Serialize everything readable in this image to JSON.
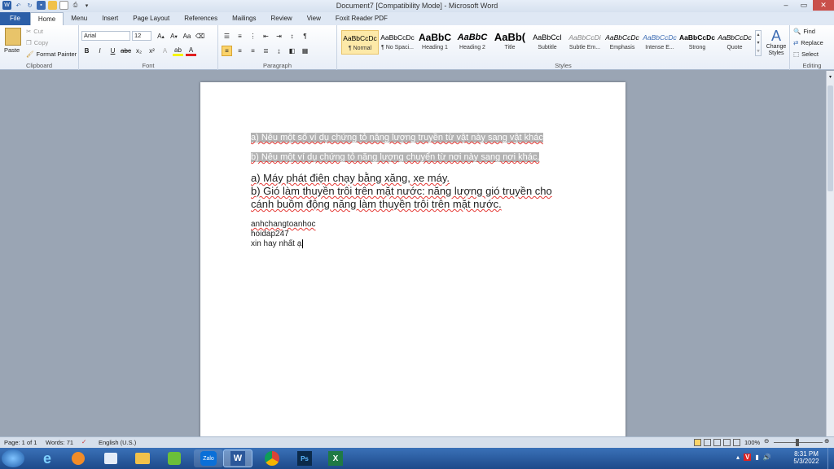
{
  "window": {
    "title": "Document7 [Compatibility Mode] - Microsoft Word",
    "controls": [
      "–",
      "▭",
      "✕"
    ]
  },
  "tabs": [
    "File",
    "Home",
    "Menu",
    "Insert",
    "Page Layout",
    "References",
    "Mailings",
    "Review",
    "View",
    "Foxit Reader PDF"
  ],
  "ribbon": {
    "clipboard": {
      "label": "Clipboard",
      "paste": "Paste",
      "cut": "Cut",
      "copy": "Copy",
      "format_painter": "Format Painter"
    },
    "font": {
      "label": "Font",
      "family": "Arial",
      "size": "12"
    },
    "paragraph": {
      "label": "Paragraph"
    },
    "styles": {
      "label": "Styles",
      "items": [
        {
          "preview": "AaBbCcDc",
          "name": "¶ Normal"
        },
        {
          "preview": "AaBbCcDc",
          "name": "¶ No Spaci..."
        },
        {
          "preview": "AaBbC",
          "name": "Heading 1"
        },
        {
          "preview": "AaBbC",
          "name": "Heading 2"
        },
        {
          "preview": "AaBb(",
          "name": "Title"
        },
        {
          "preview": "AaBbCcI",
          "name": "Subtitle"
        },
        {
          "preview": "AaBbCcDi",
          "name": "Subtle Em..."
        },
        {
          "preview": "AaBbCcDc",
          "name": "Emphasis"
        },
        {
          "preview": "AaBbCcDc",
          "name": "Intense E..."
        },
        {
          "preview": "AaBbCcDc",
          "name": "Strong"
        },
        {
          "preview": "AaBbCcDc",
          "name": "Quote"
        }
      ],
      "change_styles": "Change Styles"
    },
    "editing": {
      "label": "Editing",
      "find": "Find",
      "replace": "Replace",
      "select": "Select"
    }
  },
  "document": {
    "line1": "a) Nêu một số ví dụ chứng tỏ năng lượng truyền từ vật này sang vật khác",
    "line2": "b) Nêu một ví dụ chứng tỏ năng lượng chuyển từ nơi này sang nơi khác.",
    "answer_a": "a) Máy phát điện chạy bằng xăng, xe máy.",
    "answer_b1": "b) Gió làm thuyền trôi trên mặt nước: năng lượng gió truyền cho",
    "answer_b2": "cánh buồm động năng làm thuyền trôi trên mặt nước.",
    "sig1": "anhchangtoanhoc",
    "sig2": "hoidap247",
    "sig3": "xin hay nhất ạ"
  },
  "status": {
    "page": "Page: 1 of 1",
    "words": "Words: 71",
    "language": "English (U.S.)",
    "zoom": "100%"
  },
  "taskbar": {
    "apps": [
      "Start",
      "Internet Explorer",
      "Media Player",
      "Outlook",
      "Folder",
      "Green app",
      "Zalo",
      "Word",
      "Chrome",
      "Photoshop",
      "Excel"
    ],
    "time": "8:31 PM",
    "date": "5/3/2022",
    "zalo_label": "Zalo",
    "ps_label": "Ps",
    "lang": "V"
  }
}
